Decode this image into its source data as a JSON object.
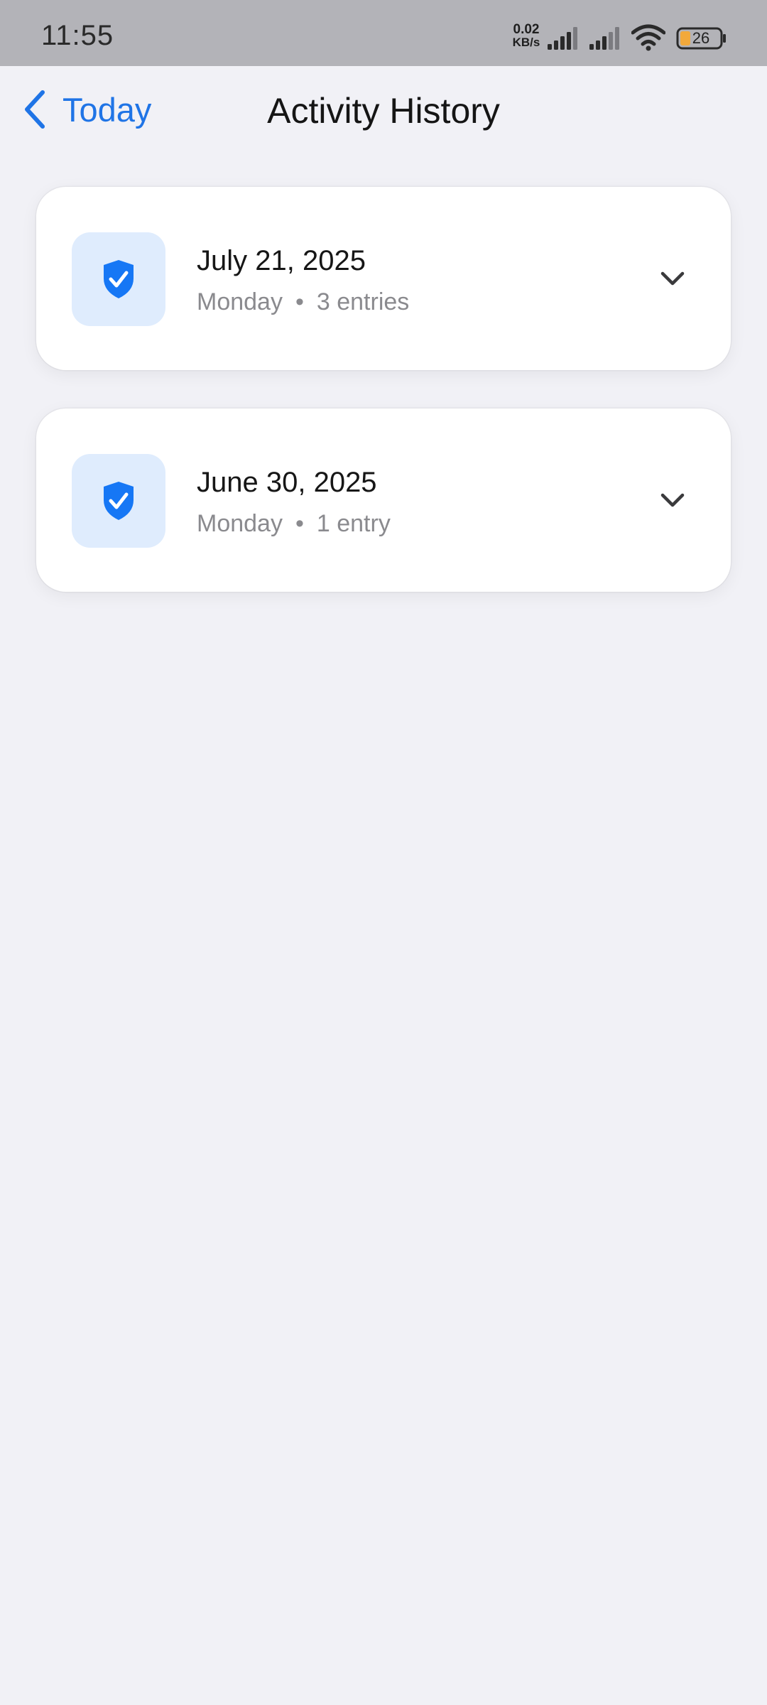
{
  "status_bar": {
    "time": "11:55",
    "net_speed_value": "0.02",
    "net_speed_unit": "KB/s",
    "battery_level": "26",
    "icons": [
      "signal-icon",
      "signal-icon",
      "wifi-icon",
      "battery-icon"
    ]
  },
  "header": {
    "back_label": "Today",
    "title": "Activity History",
    "accent_color": "#1f74e6"
  },
  "entries": [
    {
      "date": "July 21, 2025",
      "weekday": "Monday",
      "separator": "•",
      "count": "3 entries",
      "icon": "shield-check-icon",
      "expand_icon": "chevron-down-icon"
    },
    {
      "date": "June 30, 2025",
      "weekday": "Monday",
      "separator": "•",
      "count": "1 entry",
      "icon": "shield-check-icon",
      "expand_icon": "chevron-down-icon"
    }
  ],
  "colors": {
    "background": "#f1f1f6",
    "status_bar": "#b3b3b8",
    "icon_tile": "#dfecfd",
    "shield": "#1677f5",
    "meta_text": "#8a8a8e"
  }
}
